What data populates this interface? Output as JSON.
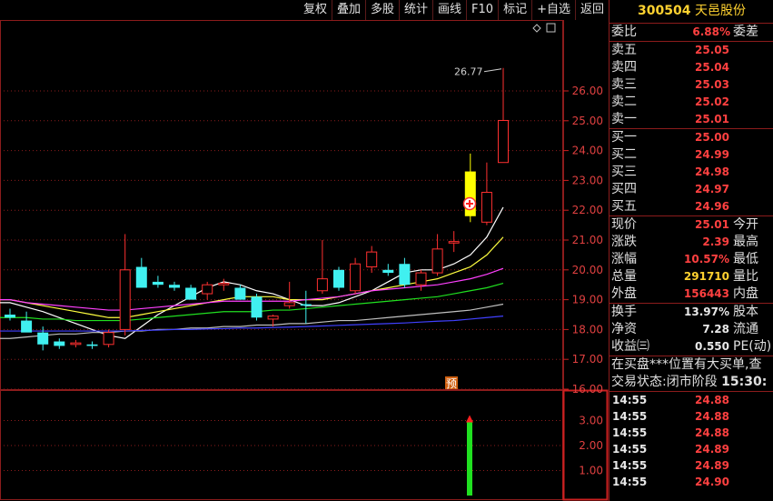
{
  "toolbar": [
    "复权",
    "叠加",
    "多股",
    "统计",
    "画线",
    "F10",
    "标记",
    "+自选",
    "返回"
  ],
  "stock": {
    "code": "300504",
    "name": "天邑股份"
  },
  "price_axis": [
    "26.00",
    "25.00",
    "24.00",
    "23.00",
    "22.00",
    "21.00",
    "20.00",
    "19.00",
    "18.00",
    "17.00",
    "16.00"
  ],
  "volume_axis": [
    "3.00",
    "2.00",
    "1.00"
  ],
  "high_marker": "26.77",
  "pre_label": "预",
  "order_ratio": {
    "label": "委比",
    "value": "6.88%",
    "label2": "委差"
  },
  "asks": [
    {
      "label": "卖五",
      "price": "25.05"
    },
    {
      "label": "卖四",
      "price": "25.04"
    },
    {
      "label": "卖三",
      "price": "25.03"
    },
    {
      "label": "卖二",
      "price": "25.02"
    },
    {
      "label": "卖一",
      "price": "25.01"
    }
  ],
  "bids": [
    {
      "label": "买一",
      "price": "25.00"
    },
    {
      "label": "买二",
      "price": "24.99"
    },
    {
      "label": "买三",
      "price": "24.98"
    },
    {
      "label": "买四",
      "price": "24.97"
    },
    {
      "label": "买五",
      "price": "24.96"
    }
  ],
  "quote": [
    {
      "label": "现价",
      "value": "25.01",
      "color": "#ff4040",
      "label2": "今开"
    },
    {
      "label": "涨跌",
      "value": "2.39",
      "color": "#ff4040",
      "label2": "最高"
    },
    {
      "label": "涨幅",
      "value": "10.57%",
      "color": "#ff4040",
      "label2": "最低"
    },
    {
      "label": "总量",
      "value": "291710",
      "color": "#ffd230",
      "label2": "量比"
    },
    {
      "label": "外盘",
      "value": "156443",
      "color": "#ff4040",
      "label2": "内盘"
    }
  ],
  "stats": [
    {
      "label": "换手",
      "value": "13.97%",
      "label2": "股本"
    },
    {
      "label": "净资",
      "value": "7.28",
      "label2": "流通"
    },
    {
      "label": "收益㈢",
      "value": "0.550",
      "label2": "PE(动)"
    }
  ],
  "message": "在买盘***位置有大买单,查",
  "trade_status": {
    "label": "交易状态:",
    "value": "闭市阶段",
    "time": "15:30:"
  },
  "ticks": [
    {
      "time": "14:55",
      "price": "24.88"
    },
    {
      "time": "14:55",
      "price": "24.88"
    },
    {
      "time": "14:55",
      "price": "24.88"
    },
    {
      "time": "14:55",
      "price": "24.89"
    },
    {
      "time": "14:55",
      "price": "24.89"
    },
    {
      "time": "14:55",
      "price": "24.90"
    }
  ],
  "candles": [
    {
      "o": 18.5,
      "h": 18.7,
      "l": 18.3,
      "c": 18.4
    },
    {
      "o": 18.3,
      "h": 18.6,
      "l": 18.0,
      "c": 17.9
    },
    {
      "o": 17.9,
      "h": 18.1,
      "l": 17.3,
      "c": 17.5
    },
    {
      "o": 17.6,
      "h": 17.7,
      "l": 17.35,
      "c": 17.45
    },
    {
      "o": 17.5,
      "h": 17.65,
      "l": 17.4,
      "c": 17.55
    },
    {
      "o": 17.5,
      "h": 17.6,
      "l": 17.35,
      "c": 17.45
    },
    {
      "o": 17.5,
      "h": 18.0,
      "l": 17.4,
      "c": 17.9
    },
    {
      "o": 18.0,
      "h": 21.2,
      "l": 17.8,
      "c": 20.0
    },
    {
      "o": 20.1,
      "h": 20.4,
      "l": 19.4,
      "c": 19.4
    },
    {
      "o": 19.6,
      "h": 19.8,
      "l": 19.4,
      "c": 19.5
    },
    {
      "o": 19.5,
      "h": 19.6,
      "l": 19.3,
      "c": 19.4
    },
    {
      "o": 19.4,
      "h": 19.5,
      "l": 19.0,
      "c": 19.0
    },
    {
      "o": 19.2,
      "h": 19.6,
      "l": 19.0,
      "c": 19.5
    },
    {
      "o": 19.5,
      "h": 19.7,
      "l": 19.3,
      "c": 19.55
    },
    {
      "o": 19.4,
      "h": 19.5,
      "l": 19.0,
      "c": 19.0
    },
    {
      "o": 19.1,
      "h": 19.2,
      "l": 18.3,
      "c": 18.4
    },
    {
      "o": 18.35,
      "h": 18.5,
      "l": 18.1,
      "c": 18.45
    },
    {
      "o": 18.8,
      "h": 19.6,
      "l": 18.7,
      "c": 18.9
    },
    {
      "o": 18.85,
      "h": 19.3,
      "l": 18.2,
      "c": 18.8
    },
    {
      "o": 19.3,
      "h": 21.0,
      "l": 19.2,
      "c": 19.7
    },
    {
      "o": 20.0,
      "h": 20.1,
      "l": 19.3,
      "c": 19.4
    },
    {
      "o": 19.3,
      "h": 20.4,
      "l": 19.2,
      "c": 20.2
    },
    {
      "o": 20.1,
      "h": 20.8,
      "l": 19.9,
      "c": 20.6
    },
    {
      "o": 20.0,
      "h": 20.2,
      "l": 19.8,
      "c": 19.9
    },
    {
      "o": 20.2,
      "h": 20.4,
      "l": 19.4,
      "c": 19.5
    },
    {
      "o": 19.5,
      "h": 20.0,
      "l": 19.3,
      "c": 19.9
    },
    {
      "o": 19.9,
      "h": 21.2,
      "l": 19.8,
      "c": 20.7
    },
    {
      "o": 20.9,
      "h": 21.3,
      "l": 20.6,
      "c": 20.95
    },
    {
      "o": 23.3,
      "h": 23.9,
      "l": 21.6,
      "c": 21.8
    },
    {
      "o": 21.6,
      "h": 23.6,
      "l": 21.5,
      "c": 22.6
    },
    {
      "o": 23.6,
      "h": 26.77,
      "l": 23.6,
      "c": 25.01
    }
  ],
  "ma_lines": [
    {
      "color": "#ffffff",
      "points": [
        18.9,
        18.75,
        18.6,
        18.4,
        18.2,
        18.0,
        17.8,
        17.7,
        18.1,
        18.5,
        18.8,
        19.1,
        19.4,
        19.6,
        19.5,
        19.3,
        19.2,
        19.0,
        18.8,
        18.8,
        18.9,
        19.1,
        19.3,
        19.6,
        19.9,
        20.0,
        20.0,
        20.2,
        20.5,
        21.1,
        22.1
      ]
    },
    {
      "color": "#ffff40",
      "points": [
        19.0,
        18.9,
        18.8,
        18.7,
        18.6,
        18.5,
        18.4,
        18.4,
        18.5,
        18.6,
        18.7,
        18.8,
        18.9,
        19.0,
        19.1,
        19.1,
        19.1,
        19.0,
        19.0,
        19.0,
        19.1,
        19.2,
        19.3,
        19.4,
        19.5,
        19.6,
        19.7,
        19.9,
        20.1,
        20.5,
        21.1
      ]
    },
    {
      "color": "#ff40ff",
      "points": [
        19.0,
        18.9,
        18.85,
        18.8,
        18.75,
        18.7,
        18.65,
        18.65,
        18.7,
        18.75,
        18.8,
        18.85,
        18.9,
        18.95,
        18.95,
        18.95,
        18.95,
        18.95,
        19.0,
        19.05,
        19.1,
        19.2,
        19.3,
        19.35,
        19.4,
        19.45,
        19.5,
        19.6,
        19.7,
        19.85,
        20.05
      ]
    },
    {
      "color": "#20e020",
      "points": [
        18.4,
        18.4,
        18.35,
        18.35,
        18.3,
        18.3,
        18.3,
        18.3,
        18.35,
        18.4,
        18.45,
        18.5,
        18.55,
        18.6,
        18.6,
        18.6,
        18.65,
        18.65,
        18.7,
        18.75,
        18.8,
        18.85,
        18.9,
        18.95,
        19.0,
        19.05,
        19.1,
        19.2,
        19.3,
        19.4,
        19.55
      ]
    },
    {
      "color": "#c0c0c0",
      "points": [
        17.7,
        17.75,
        17.8,
        17.85,
        17.85,
        17.9,
        17.9,
        17.95,
        17.95,
        18.0,
        18.0,
        18.05,
        18.05,
        18.1,
        18.1,
        18.15,
        18.15,
        18.2,
        18.2,
        18.25,
        18.3,
        18.3,
        18.35,
        18.4,
        18.45,
        18.5,
        18.55,
        18.6,
        18.65,
        18.75,
        18.85
      ]
    },
    {
      "color": "#4040ff",
      "points": [
        17.95,
        17.95,
        17.95,
        17.95,
        17.95,
        17.95,
        17.95,
        17.95,
        17.97,
        17.98,
        18.0,
        18.0,
        18.02,
        18.03,
        18.05,
        18.05,
        18.07,
        18.08,
        18.1,
        18.12,
        18.14,
        18.16,
        18.18,
        18.2,
        18.22,
        18.25,
        18.28,
        18.3,
        18.35,
        18.4,
        18.45
      ]
    }
  ],
  "volume_bar": {
    "value": 3.0
  }
}
